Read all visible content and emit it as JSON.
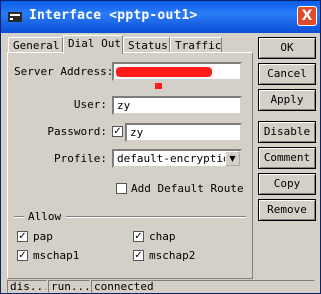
{
  "window": {
    "title": "Interface <pptp-out1>",
    "close_symbol": "X"
  },
  "tabs": [
    {
      "label": "General"
    },
    {
      "label": "Dial Out"
    },
    {
      "label": "Status"
    },
    {
      "label": "Traffic"
    }
  ],
  "form": {
    "server_address_label": "Server Address:",
    "server_address_value": "",
    "user_label": "User:",
    "user_value": "zy",
    "password_label": "Password:",
    "password_value": "zy",
    "profile_label": "Profile:",
    "profile_value": "default-encryption",
    "add_default_route_label": "Add Default Route",
    "add_default_route_checked": false
  },
  "allow": {
    "title": "Allow",
    "options": [
      {
        "label": "pap",
        "checked": true
      },
      {
        "label": "chap",
        "checked": true
      },
      {
        "label": "mschap1",
        "checked": true
      },
      {
        "label": "mschap2",
        "checked": true
      }
    ]
  },
  "buttons": {
    "ok": "OK",
    "cancel": "Cancel",
    "apply": "Apply",
    "disable": "Disable",
    "comment": "Comment",
    "copy": "Copy",
    "remove": "Remove"
  },
  "status_bar": [
    "dis...",
    "run...",
    "connected"
  ],
  "colors": {
    "titlebar": "#0a5ee8",
    "redaction": "#ff1a1a",
    "window_bg": "#d4d0c8"
  }
}
